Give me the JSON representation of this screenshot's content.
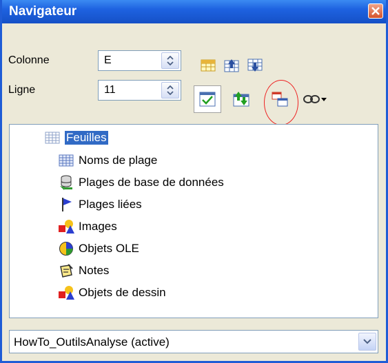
{
  "window": {
    "title": "Navigateur"
  },
  "fields": {
    "colonne_label": "Colonne",
    "colonne_value": "E",
    "ligne_label": "Ligne",
    "ligne_value": "11"
  },
  "tree": {
    "items": [
      {
        "label": "Feuilles",
        "icon": "sheets-icon",
        "selected": true
      },
      {
        "label": "Noms de plage",
        "icon": "range-names-icon"
      },
      {
        "label": "Plages de base de données",
        "icon": "database-range-icon"
      },
      {
        "label": "Plages liées",
        "icon": "linked-area-icon"
      },
      {
        "label": "Images",
        "icon": "images-icon"
      },
      {
        "label": "Objets OLE",
        "icon": "ole-object-icon"
      },
      {
        "label": "Notes",
        "icon": "notes-icon"
      },
      {
        "label": "Objets de dessin",
        "icon": "drawing-object-icon"
      }
    ]
  },
  "document_select": {
    "value": "HowTo_OutilsAnalyse (active)"
  },
  "colors": {
    "title_bar": "#1e62e0",
    "selection": "#316ac5",
    "annotation": "#e22222"
  }
}
